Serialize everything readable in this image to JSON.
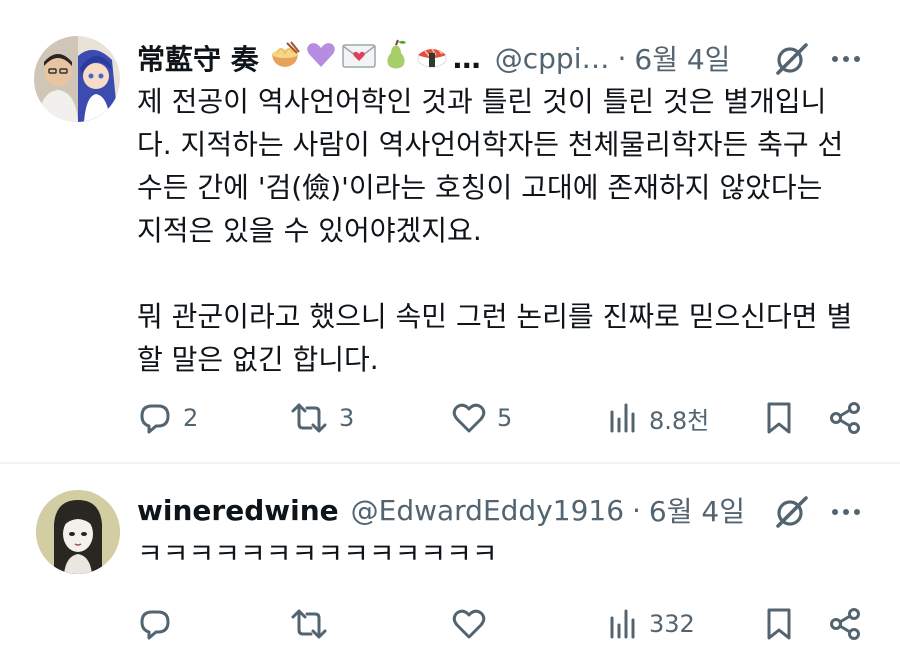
{
  "tweets": [
    {
      "display_name": "常藍守 奏",
      "name_emojis": [
        "noodle-bowl",
        "purple-heart",
        "love-letter",
        "pear",
        "sushi"
      ],
      "ellipsis": "…",
      "handle": "@cppi…",
      "separator": "·",
      "date": "6월 4일",
      "paragraphs": [
        "제 전공이 역사언어학인 것과 틀린 것이 틀린 것은 별개입니다. 지적하는 사람이 역사언어학자든 천체물리학자든 축구 선수든 간에 '검(儉)'이라는 호칭이 고대에 존재하지 않았다는 지적은 있을 수 있어야겠지요.",
        "뭐 관군이라고 했으니 속민 그런 논리를 진짜로 믿으신다면 별 할 말은 없긴 합니다."
      ],
      "replies": "2",
      "retweets": "3",
      "likes": "5",
      "views": "8.8천"
    },
    {
      "display_name": "wineredwine",
      "handle": "@EdwardEddy1916",
      "separator": "·",
      "date": "6월 4일",
      "paragraphs": [
        "ㅋㅋㅋㅋㅋㅋㅋㅋㅋㅋㅋㅋㅋㅋ"
      ],
      "replies": "",
      "retweets": "",
      "likes": "",
      "views": "332"
    }
  ],
  "icons": {
    "reply": "reply-icon",
    "retweet": "retweet-icon",
    "like": "heart-icon",
    "views": "views-chart-icon",
    "bookmark": "bookmark-icon",
    "share": "share-icon",
    "grok": "grok-icon",
    "more": "more-dots-icon"
  },
  "colors": {
    "text_primary": "#0f1419",
    "text_secondary": "#536471",
    "divider": "#eff3f4"
  }
}
